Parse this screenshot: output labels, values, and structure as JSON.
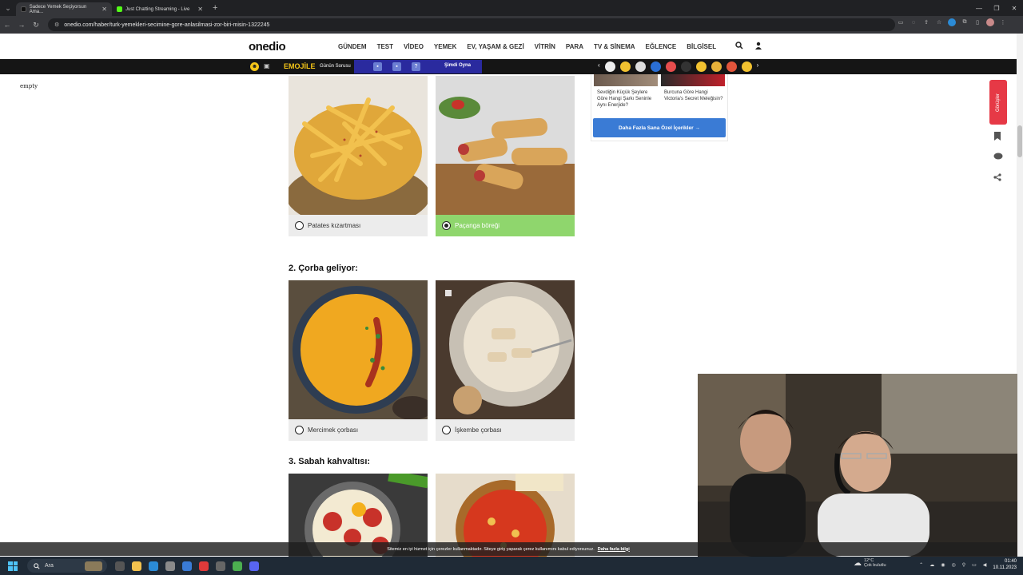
{
  "browser": {
    "tabs": [
      {
        "label": "Sadece Yemek Seçiyorsun Ama...",
        "active": true
      },
      {
        "label": "Just Chatting Streaming - Live",
        "active": false
      }
    ],
    "url": "onedio.com/haber/turk-yemekleri-secimine-gore-anlasilmasi-zor-biri-misin-1322245"
  },
  "site": {
    "logo": "onedio",
    "menu": [
      "GÜNDEM",
      "TEST",
      "VİDEO",
      "YEMEK",
      "EV, YAŞAM & GEZİ",
      "VİTRİN",
      "PARA",
      "TV & SİNEMA",
      "EĞLENCE",
      "BİLGİSEL"
    ],
    "strip": {
      "emojile": "EMOJİLE",
      "gunun_sorusu": "Günün Sorusu",
      "quiz_mark": "?",
      "play": "Şimdi Oyna"
    }
  },
  "left_label": "empty",
  "quiz": {
    "q1": {
      "options": [
        {
          "label": "Patates kızartması",
          "selected": false
        },
        {
          "label": "Paçanga böreği",
          "selected": true
        }
      ]
    },
    "q2": {
      "title": "2. Çorba geliyor:",
      "options": [
        {
          "label": "Mercimek çorbası",
          "selected": false
        },
        {
          "label": "İşkembe çorbası",
          "selected": false
        }
      ]
    },
    "q3": {
      "title": "3. Sabah kahvaltısı:"
    }
  },
  "sidebar": {
    "rec1": "Sevdiğin Küçük Şeylere Göre Hangi Şarkı Seninle Aynı Enerjide?",
    "rec2": "Burcuna Göre Hangi Victoria's Secret Meleğisin?",
    "more_button": "Daha Fazla Sana Özel İçerikler →",
    "side_tab": "Görüşler"
  },
  "cookie": {
    "text": "Sitemiz en iyi hizmet için çerezler kullanmaktadır. Siteye giriş yaparak çerez kullanımını kabul ediyorsunuz.",
    "link": "Daha fazla bilgi"
  },
  "taskbar": {
    "search": "Ara",
    "weather_temp": "12°C",
    "weather_desc": "Çok bulutlu",
    "time": "01:40",
    "date": "10.11.2023"
  }
}
